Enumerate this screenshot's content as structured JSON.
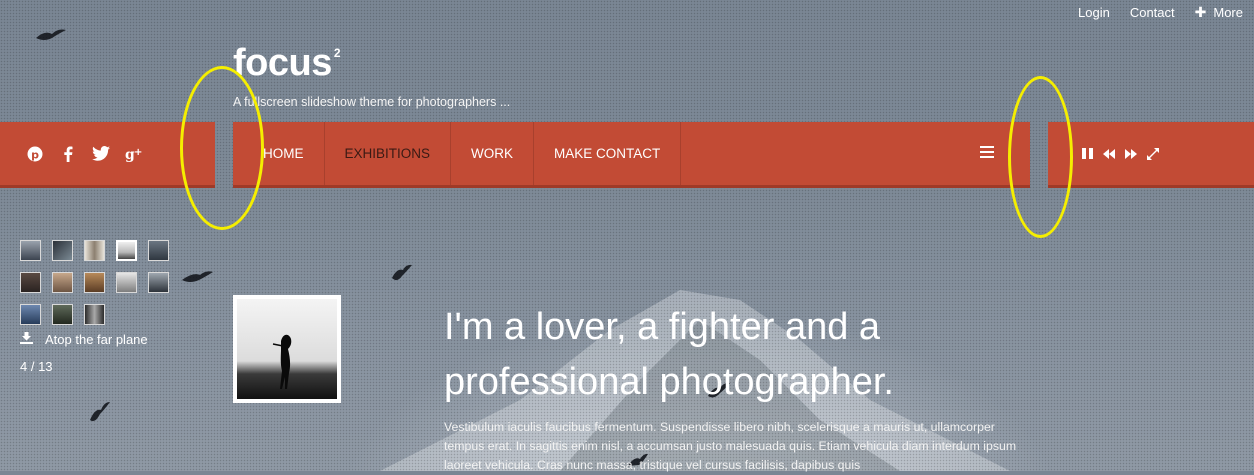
{
  "top_links": {
    "login": "Login",
    "contact": "Contact",
    "more": "More"
  },
  "brand": {
    "name": "focus",
    "superscript": "2",
    "tagline": "A fullscreen slideshow theme for photographers  ..."
  },
  "social": [
    "pinterest-icon",
    "facebook-icon",
    "twitter-icon",
    "google-plus-icon"
  ],
  "nav": {
    "items": [
      "HOME",
      "EXHIBITIONS",
      "WORK",
      "MAKE CONTACT"
    ],
    "active": "EXHIBITIONS"
  },
  "controls": [
    "pause-icon",
    "rewind-icon",
    "fast-forward-icon",
    "fullscreen-icon"
  ],
  "thumbnails": {
    "count": 13,
    "active_index": 4
  },
  "caption": "Atop the far plane",
  "counter": "4 / 13",
  "headline": "I'm a lover, a fighter and a professional photographer.",
  "body": "Vestibulum iaculis faucibus fermentum. Suspendisse libero nibh, scelerisque a mauris ut, ullamcorper tempus erat. In sagittis enim nisl, a accumsan justo malesuada quis. Etiam vehicula diam interdum ipsum laoreet vehicula. Cras nunc massa, tristique vel cursus facilisis, dapibus quis",
  "colors": {
    "bar": "#c24b35",
    "highlight": "#f5ee00",
    "background": "#7e8a97"
  }
}
